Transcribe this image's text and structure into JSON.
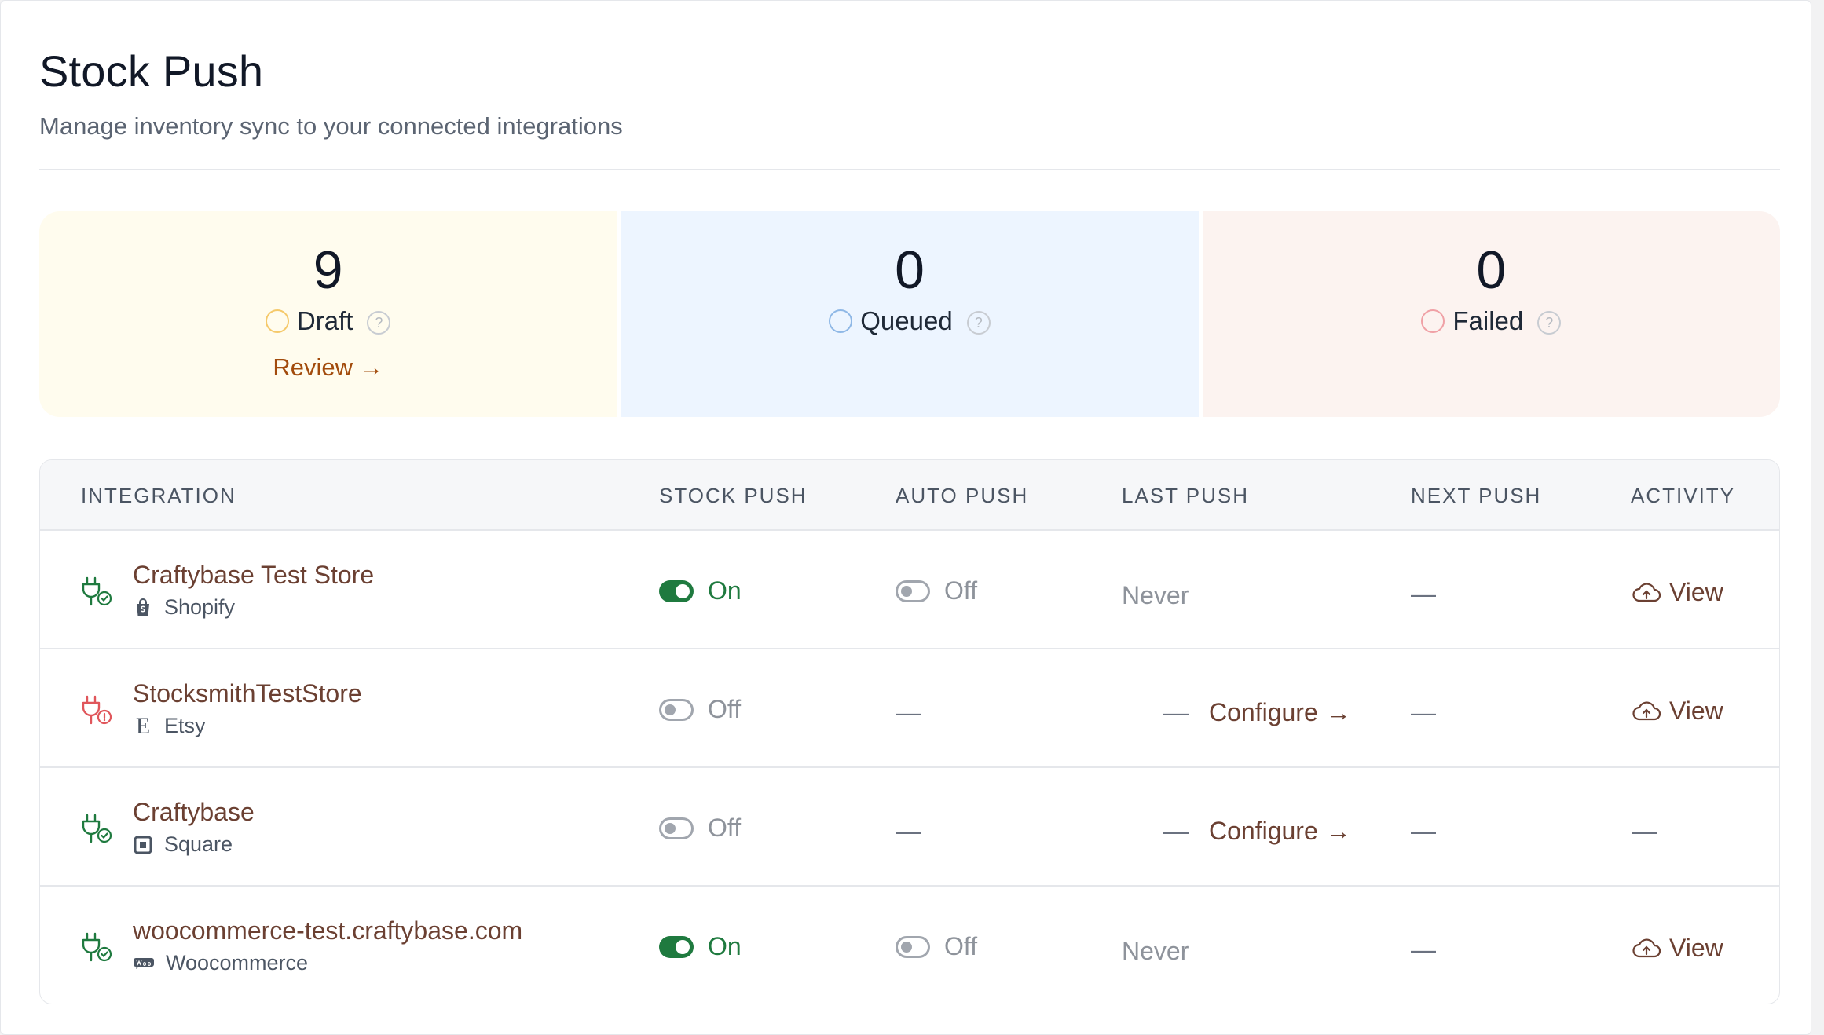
{
  "header": {
    "title": "Stock Push",
    "subtitle": "Manage inventory sync to your connected integrations"
  },
  "stats": [
    {
      "value": "9",
      "label": "Draft",
      "action": "Review",
      "bg": "#fffcee",
      "ring": "#f5c96a"
    },
    {
      "value": "0",
      "label": "Queued",
      "bg": "#edf5ff",
      "ring": "#8fb8e6"
    },
    {
      "value": "0",
      "label": "Failed",
      "bg": "#fcf3f0",
      "ring": "#f0a1a6"
    }
  ],
  "table": {
    "columns": [
      "INTEGRATION",
      "STOCK PUSH",
      "AUTO PUSH",
      "LAST PUSH",
      "NEXT PUSH",
      "ACTIVITY"
    ],
    "rows": [
      {
        "name": "Craftybase Test Store",
        "platform": "Shopify",
        "platform_icon": "shopify-bag-icon",
        "status_icon": "plug-check-icon",
        "stock_push": "On",
        "auto_push": "Off",
        "last_push": "Never",
        "next_push": "—",
        "activity": "View"
      },
      {
        "name": "StocksmithTestStore",
        "platform": "Etsy",
        "platform_icon": "etsy-e-icon",
        "status_icon": "plug-alert-icon",
        "stock_push": "Off",
        "auto_push": "—",
        "last_push_dash": "—",
        "last_push_action": "Configure",
        "next_push": "—",
        "activity": "View"
      },
      {
        "name": "Craftybase",
        "platform": "Square",
        "platform_icon": "square-icon",
        "status_icon": "plug-check-icon",
        "stock_push": "Off",
        "auto_push": "—",
        "last_push_dash": "—",
        "last_push_action": "Configure",
        "next_push": "—",
        "activity": "—"
      },
      {
        "name": "woocommerce-test.craftybase.com",
        "platform": "Woocommerce",
        "platform_icon": "woo-icon",
        "status_icon": "plug-check-icon",
        "stock_push": "On",
        "auto_push": "Off",
        "last_push": "Never",
        "next_push": "—",
        "activity": "View"
      }
    ]
  },
  "colors": {
    "brand_link": "#6b4032",
    "on_green": "#1f7a3f",
    "alert_red": "#e0565b"
  }
}
